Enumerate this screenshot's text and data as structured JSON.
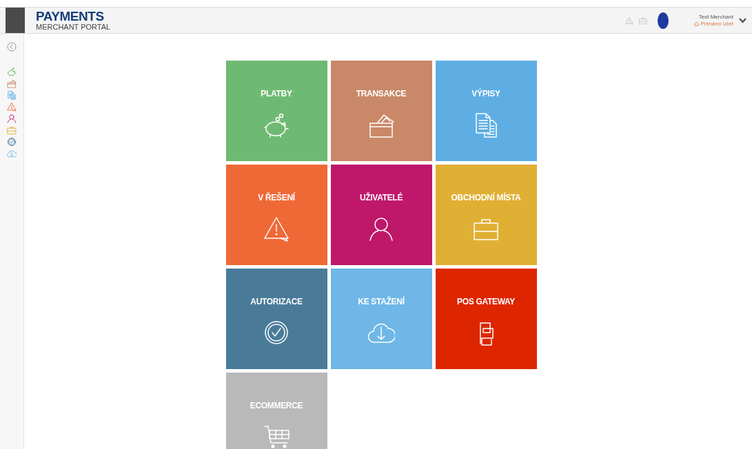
{
  "header": {
    "title": "PAYMENTS",
    "subtitle": "MERCHANT PORTAL",
    "user": {
      "name": "Test Merchant",
      "account": "Primární účet"
    }
  },
  "sidebar": {
    "items": [
      {
        "kind": "piggy"
      },
      {
        "kind": "card"
      },
      {
        "kind": "docs"
      },
      {
        "kind": "warning"
      },
      {
        "kind": "user"
      },
      {
        "kind": "briefcase"
      },
      {
        "kind": "check"
      },
      {
        "kind": "cloud"
      }
    ]
  },
  "tiles": [
    {
      "label": "PLATBY",
      "kind": "piggy",
      "color": "#6fba72"
    },
    {
      "label": "TRANSAKCE",
      "kind": "card",
      "color": "#c98868"
    },
    {
      "label": "VÝPISY",
      "kind": "docs",
      "color": "#5faee3"
    },
    {
      "label": "V ŘEŠENÍ",
      "kind": "warning",
      "color": "#ef6937"
    },
    {
      "label": "UŽIVATELÉ",
      "kind": "user",
      "color": "#bf186b"
    },
    {
      "label": "OBCHODNÍ MÍSTA",
      "kind": "briefcase",
      "color": "#e0b034"
    },
    {
      "label": "AUTORIZACE",
      "kind": "check",
      "color": "#497b99"
    },
    {
      "label": "KE STAŽENÍ",
      "kind": "cloud",
      "color": "#6eb7e6"
    },
    {
      "label": "POS GATEWAY",
      "kind": "gateway",
      "color": "#dd2600"
    },
    {
      "label": "ECOMMERCE",
      "kind": "cart",
      "color": "#b9b9b9"
    }
  ]
}
